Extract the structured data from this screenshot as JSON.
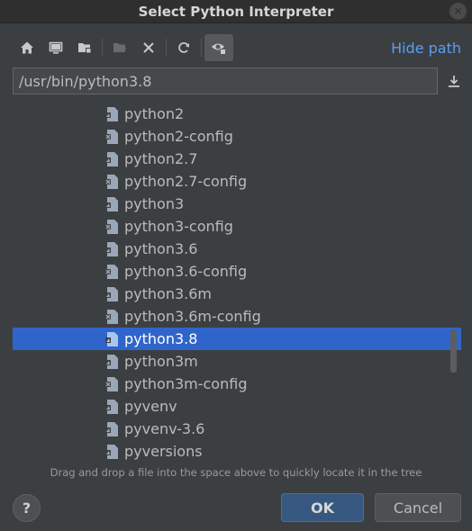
{
  "window": {
    "title": "Select Python Interpreter",
    "close_glyph": "✕"
  },
  "toolbar": {
    "buttons": [
      {
        "name": "home-icon"
      },
      {
        "name": "desktop-icon"
      },
      {
        "name": "project-folder-icon"
      },
      {
        "name": "new-folder-icon"
      },
      {
        "name": "delete-icon"
      },
      {
        "name": "refresh-icon"
      },
      {
        "name": "show-hidden-files-icon",
        "active": true
      }
    ],
    "hide_path_label": "Hide path"
  },
  "path_field": {
    "value": "/usr/bin/python3.8"
  },
  "tree": {
    "items": [
      {
        "label": "python2",
        "kind": "python"
      },
      {
        "label": "python2-config",
        "kind": "config"
      },
      {
        "label": "python2.7",
        "kind": "python"
      },
      {
        "label": "python2.7-config",
        "kind": "config"
      },
      {
        "label": "python3",
        "kind": "python"
      },
      {
        "label": "python3-config",
        "kind": "config"
      },
      {
        "label": "python3.6",
        "kind": "python"
      },
      {
        "label": "python3.6-config",
        "kind": "config"
      },
      {
        "label": "python3.6m",
        "kind": "python"
      },
      {
        "label": "python3.6m-config",
        "kind": "config"
      },
      {
        "label": "python3.8",
        "kind": "python",
        "selected": true
      },
      {
        "label": "python3m",
        "kind": "python"
      },
      {
        "label": "python3m-config",
        "kind": "config"
      },
      {
        "label": "pyvenv",
        "kind": "python"
      },
      {
        "label": "pyvenv-3.6",
        "kind": "python"
      },
      {
        "label": "pyversions",
        "kind": "python"
      }
    ]
  },
  "hint": "Drag and drop a file into the space above to quickly locate it in the tree",
  "buttons": {
    "help": "?",
    "ok": "OK",
    "cancel": "Cancel"
  },
  "colors": {
    "background": "#3c3f41",
    "selection": "#2f65ca",
    "link": "#589df6",
    "ok_button": "#365880"
  }
}
